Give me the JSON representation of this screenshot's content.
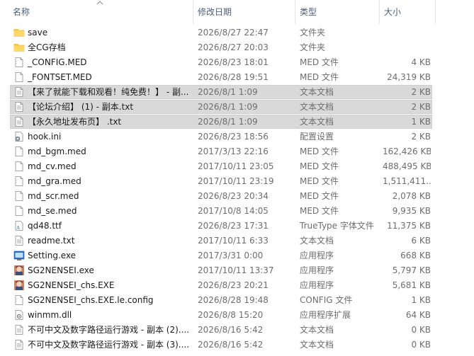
{
  "header": {
    "col_name": "名称",
    "col_date": "修改日期",
    "col_type": "类型",
    "col_size": "大小"
  },
  "files": [
    {
      "name": "save",
      "date": "2026/8/27 22:47",
      "type": "文件夹",
      "size": "",
      "icon": "folder-icon",
      "selected": false
    },
    {
      "name": "全CG存档",
      "date": "2026/8/27 20:03",
      "type": "文件夹",
      "size": "",
      "icon": "folder-icon",
      "selected": false
    },
    {
      "name": "_CONFIG.MED",
      "date": "2026/8/23 18:01",
      "type": "MED 文件",
      "size": "4 KB",
      "icon": "file-icon",
      "selected": false
    },
    {
      "name": "_FONTSET.MED",
      "date": "2026/8/28 19:51",
      "type": "MED 文件",
      "size": "24,319 KB",
      "icon": "file-icon",
      "selected": false
    },
    {
      "name": "【来了就能下载和观看！纯免费！】 - 副...",
      "date": "2026/8/1 1:09",
      "type": "文本文档",
      "size": "2 KB",
      "icon": "text-file-icon",
      "selected": true
    },
    {
      "name": "【论坛介绍】 (1) - 副本.txt",
      "date": "2026/8/1 1:09",
      "type": "文本文档",
      "size": "2 KB",
      "icon": "text-file-icon",
      "selected": true
    },
    {
      "name": "【永久地址发布页】 .txt",
      "date": "2026/8/1 1:09",
      "type": "文本文档",
      "size": "1 KB",
      "icon": "text-file-icon",
      "selected": true
    },
    {
      "name": "hook.ini",
      "date": "2026/8/23 18:56",
      "type": "配置设置",
      "size": "2 KB",
      "icon": "ini-file-icon",
      "selected": false
    },
    {
      "name": "md_bgm.med",
      "date": "2017/3/13 22:16",
      "type": "MED 文件",
      "size": "162,426 KB",
      "icon": "file-icon",
      "selected": false
    },
    {
      "name": "md_cv.med",
      "date": "2017/10/11 23:05",
      "type": "MED 文件",
      "size": "488,495 KB",
      "icon": "file-icon",
      "selected": false
    },
    {
      "name": "md_gra.med",
      "date": "2017/10/11 23:19",
      "type": "MED 文件",
      "size": "1,511,411...",
      "icon": "file-icon",
      "selected": false
    },
    {
      "name": "md_scr.med",
      "date": "2026/8/23 20:34",
      "type": "MED 文件",
      "size": "2,078 KB",
      "icon": "file-icon",
      "selected": false
    },
    {
      "name": "md_se.med",
      "date": "2017/10/8 14:05",
      "type": "MED 文件",
      "size": "9,935 KB",
      "icon": "file-icon",
      "selected": false
    },
    {
      "name": "qd48.ttf",
      "date": "2026/8/23 17:31",
      "type": "TrueType 字体文件",
      "size": "11,375 KB",
      "icon": "font-file-icon",
      "selected": false
    },
    {
      "name": "readme.txt",
      "date": "2017/10/11 6:33",
      "type": "文本文档",
      "size": "6 KB",
      "icon": "text-file-icon",
      "selected": false
    },
    {
      "name": "Setting.exe",
      "date": "2017/3/31 0:00",
      "type": "应用程序",
      "size": "668 KB",
      "icon": "settings-app-icon",
      "selected": false
    },
    {
      "name": "SG2NENSEI.exe",
      "date": "2017/10/11 13:37",
      "type": "应用程序",
      "size": "5,797 KB",
      "icon": "game-app-icon",
      "selected": false
    },
    {
      "name": "SG2NENSEI_chs.EXE",
      "date": "2026/8/23 20:21",
      "type": "应用程序",
      "size": "5,681 KB",
      "icon": "game-app-icon",
      "selected": false
    },
    {
      "name": "SG2NENSEI_chs.EXE.le.config",
      "date": "2026/8/28 19:48",
      "type": "CONFIG 文件",
      "size": "1 KB",
      "icon": "file-icon",
      "selected": false
    },
    {
      "name": "winmm.dll",
      "date": "2026/8/8 15:20",
      "type": "应用程序扩展",
      "size": "64 KB",
      "icon": "dll-file-icon",
      "selected": false
    },
    {
      "name": "不可中文及数字路径运行游戏 - 副本 (2)....",
      "date": "2026/8/16 5:42",
      "type": "文本文档",
      "size": "0 KB",
      "icon": "text-file-icon",
      "selected": false
    },
    {
      "name": "不可中文及数字路径运行游戏 - 副本 (3)....",
      "date": "2026/8/16 5:42",
      "type": "文本文档",
      "size": "0 KB",
      "icon": "text-file-icon",
      "selected": false
    }
  ]
}
